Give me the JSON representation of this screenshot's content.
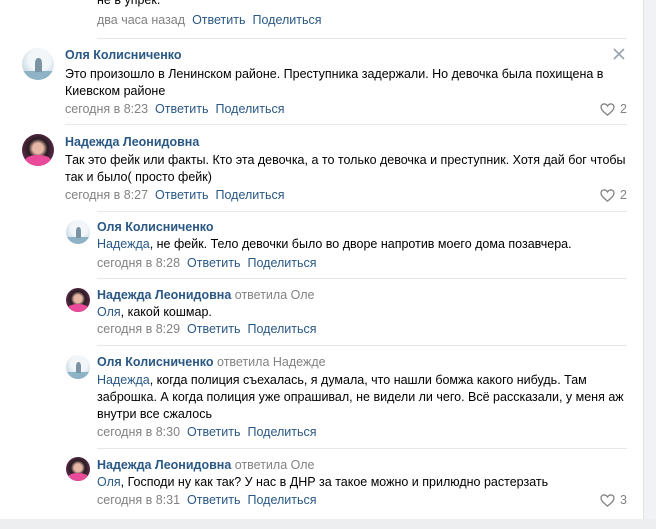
{
  "comments": [
    {
      "text": "не в упрек.",
      "time": "два часа назад",
      "reply": "Ответить",
      "share": "Поделиться"
    },
    {
      "author": "Оля Колисниченко",
      "text": "Это произошло в Ленинском районе. Преступника задержали. Но девочка была похищена в Киевском районе",
      "time": "сегодня в 8:23",
      "reply": "Ответить",
      "share": "Поделиться",
      "likes": "2"
    },
    {
      "author": "Надежда Леонидовна",
      "text": "Так это фейк или факты. Кто эта девочка, а то только девочка и преступник. Хотя дай бог чтобы так и было( просто фейк)",
      "time": "сегодня в 8:27",
      "reply": "Ответить",
      "share": "Поделиться",
      "likes": "2"
    },
    {
      "author": "Оля Колисниченко",
      "addressee": "Надежда",
      "text": ", не фейк. Тело девочки было во дворе напротив моего дома позавчера.",
      "time": "сегодня в 8:28",
      "reply": "Ответить",
      "share": "Поделиться"
    },
    {
      "author": "Надежда Леонидовна",
      "replied_to": "ответила Оле",
      "addressee": "Оля",
      "text": ", какой кошмар.",
      "time": "сегодня в 8:29",
      "reply": "Ответить",
      "share": "Поделиться"
    },
    {
      "author": "Оля Колисниченко",
      "replied_to": "ответила Надежде",
      "addressee": "Надежда",
      "text": ", когда полиция съехалась, я думала, что нашли бомжа какого нибудь. Там заброшка. А когда полиция уже опрашивал, не видели ли чего. Всё рассказали, у меня аж внутри все сжалось",
      "time": "сегодня в 8:30",
      "reply": "Ответить",
      "share": "Поделиться"
    },
    {
      "author": "Надежда Леонидовна",
      "replied_to": "ответила Оле",
      "addressee": "Оля",
      "text": ", Господи ну как так? У нас в ДНР за такое можно и прилюдно растерзать",
      "time": "сегодня в 8:31",
      "reply": "Ответить",
      "share": "Поделиться",
      "likes": "3"
    }
  ],
  "colors": {
    "link": "#2a5885",
    "meta": "#828282",
    "separator": "#e7e8ec"
  },
  "icons": [
    "close-icon",
    "heart-icon"
  ]
}
